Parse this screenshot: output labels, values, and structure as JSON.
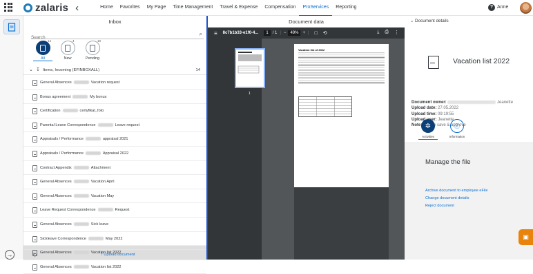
{
  "topbar": {
    "logo": "zalaris",
    "nav": [
      "Home",
      "Favorites",
      "My Page",
      "Time Management",
      "Travel & Expense",
      "Compensation",
      "ProServices",
      "Reporting"
    ],
    "active_nav": "ProServices",
    "help": "?",
    "user": "Anne"
  },
  "inbox": {
    "title": "Inbox",
    "search_placeholder": "Search",
    "filters": [
      {
        "label": "All",
        "count": "14"
      },
      {
        "label": "New",
        "count": "4"
      },
      {
        "label": "Pending",
        "count": "10"
      }
    ],
    "group": {
      "label": "Items, Incoming (EFINBOXALL)",
      "count": "14"
    },
    "items": [
      {
        "pre": "General Absences",
        "post": "Vacation request"
      },
      {
        "pre": "Bonus agreement",
        "post": "My bonus"
      },
      {
        "pre": "Certification",
        "post": "certyfikat_foto"
      },
      {
        "pre": "Parental Leave Correspondence",
        "post": "Leave request"
      },
      {
        "pre": "Appraisals / Performance",
        "post": "appraisal 2021"
      },
      {
        "pre": "Appraisals / Performance",
        "post": "Appraisal 2022"
      },
      {
        "pre": "Contract Appendix",
        "post": "Attachment"
      },
      {
        "pre": "General Absences",
        "post": "Vacation April"
      },
      {
        "pre": "General Absences",
        "post": "Vacation May"
      },
      {
        "pre": "Leave Request Correspondence",
        "post": "Request"
      },
      {
        "pre": "General Absences",
        "post": "Sick leave"
      },
      {
        "pre": "Sickleave Correspondence",
        "post": "May 2022"
      },
      {
        "pre": "General Absences",
        "post": "Vacation list 2022"
      },
      {
        "pre": "General Absences",
        "post": "Vacation list 2022"
      }
    ],
    "selected_index": 12,
    "upload_label": "Upload document"
  },
  "viewer": {
    "title": "Document data",
    "file": "8c7b1b33-e1f0-4...",
    "page": "1",
    "pages": "/ 1",
    "zoom": "49%",
    "thumb_number": "1",
    "page_heading": "Vacation list of 2022"
  },
  "details": {
    "header": "Document details",
    "name": "Vacation list 2022",
    "meta": [
      {
        "label": "Document owner:",
        "value": "Jeanette"
      },
      {
        "label": "Upload date:",
        "value": "27.05.2022"
      },
      {
        "label": "Upload time:",
        "value": "09:19:55"
      },
      {
        "label": "Upload user:",
        "value": "Jeanette"
      },
      {
        "label": "Note:",
        "value": "Please save & approve"
      }
    ],
    "tabs": [
      "Activities",
      "Information"
    ],
    "manage_title": "Manage the file",
    "actions": [
      "Archive document to employee eFile",
      "Change document details",
      "Reject document"
    ]
  },
  "icons": {
    "apps": "grid-icon",
    "back": "chevron-left-icon",
    "search": "search-icon",
    "refresh": "refresh-icon",
    "upload": "upload-icon",
    "chat": "chat-icon",
    "print": "print-icon",
    "download": "download-icon"
  },
  "colors": {
    "accent": "#0a6ed1",
    "brand_dark": "#0a3f78",
    "divider_blue": "#1a52c8",
    "chat": "#e8830c"
  }
}
